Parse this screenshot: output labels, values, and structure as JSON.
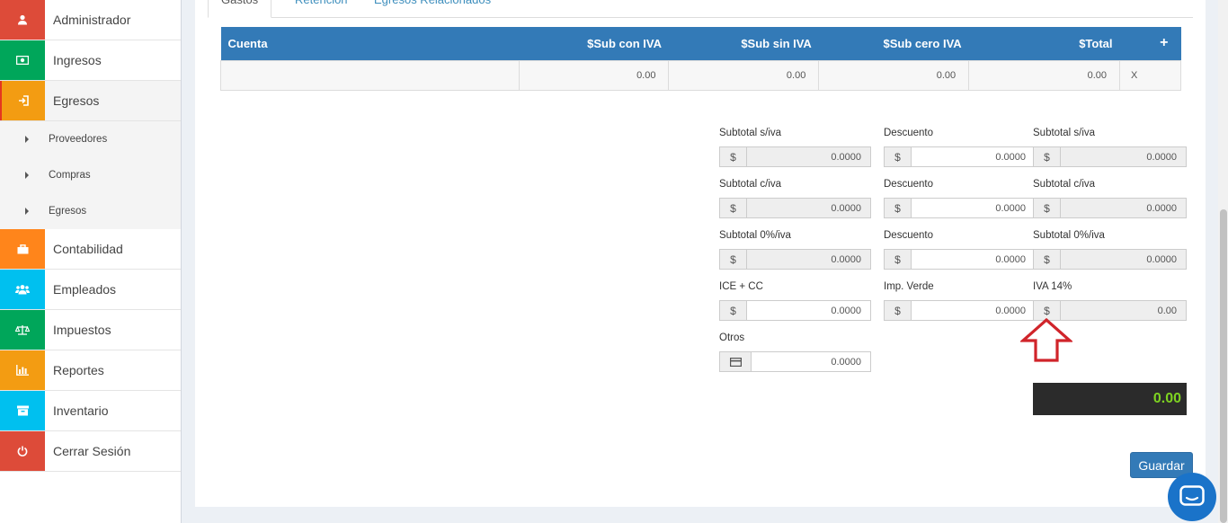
{
  "sidebar": {
    "items": [
      {
        "label": "Administrador",
        "icon": "user-icon",
        "color": "#dd4b39"
      },
      {
        "label": "Ingresos",
        "icon": "money-icon",
        "color": "#00a65a"
      },
      {
        "label": "Egresos",
        "icon": "sign-in-icon",
        "color": "#f39c12"
      },
      {
        "label": "Contabilidad",
        "icon": "briefcase-icon",
        "color": "#ff851b"
      },
      {
        "label": "Empleados",
        "icon": "users-icon",
        "color": "#00c0ef"
      },
      {
        "label": "Impuestos",
        "icon": "balance-scale-icon",
        "color": "#00a65a"
      },
      {
        "label": "Reportes",
        "icon": "bar-chart-icon",
        "color": "#f39c12"
      },
      {
        "label": "Inventario",
        "icon": "archive-icon",
        "color": "#00c0ef"
      },
      {
        "label": "Cerrar Sesión",
        "icon": "power-icon",
        "color": "#dd4b39"
      }
    ],
    "sub_items": [
      "Proveedores",
      "Compras",
      "Egresos"
    ]
  },
  "tabs": [
    "Gastos",
    "Retención",
    "Egresos Relacionados"
  ],
  "table": {
    "headers": [
      "Cuenta",
      "$Sub con IVA",
      "$Sub sin IVA",
      "$Sub cero IVA",
      "$Total"
    ],
    "row": [
      "",
      "0.00",
      "0.00",
      "0.00",
      "0.00"
    ],
    "delete_label": "X",
    "add_label": "+"
  },
  "form": {
    "currency": "$",
    "fields": {
      "subtotal_siva_1": {
        "label": "Subtotal s/iva",
        "value": "0.0000"
      },
      "descuento_1": {
        "label": "Descuento",
        "value": "0.0000"
      },
      "subtotal_siva_2": {
        "label": "Subtotal s/iva",
        "value": "0.0000"
      },
      "subtotal_civa_1": {
        "label": "Subtotal c/iva",
        "value": "0.0000"
      },
      "descuento_2": {
        "label": "Descuento",
        "value": "0.0000"
      },
      "subtotal_civa_2": {
        "label": "Subtotal c/iva",
        "value": "0.0000"
      },
      "subtotal_0iva_1": {
        "label": "Subtotal 0%/iva",
        "value": "0.0000"
      },
      "descuento_3": {
        "label": "Descuento",
        "value": "0.0000"
      },
      "subtotal_0iva_2": {
        "label": "Subtotal 0%/iva",
        "value": "0.0000"
      },
      "ice_cc": {
        "label": "ICE + CC",
        "value": "0.0000"
      },
      "imp_verde": {
        "label": "Imp. Verde",
        "value": "0.0000"
      },
      "iva": {
        "label": "IVA 14%",
        "value": "0.00"
      },
      "otros": {
        "label": "Otros",
        "value": "0.0000"
      }
    },
    "total": "0.00",
    "save_label": "Guardar"
  },
  "colors": {
    "accent": "#337ab7",
    "total_text": "#7ed321",
    "arrow": "#d0242a"
  }
}
